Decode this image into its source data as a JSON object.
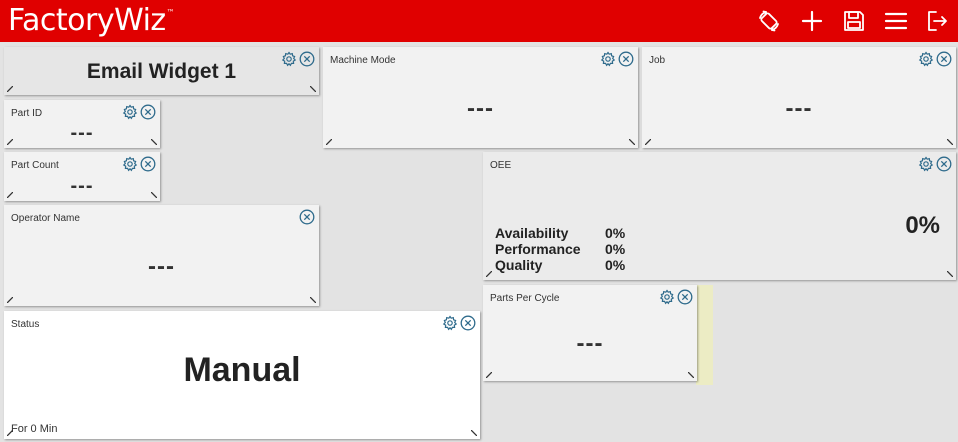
{
  "app": {
    "logo_text": "FactoryWiz",
    "trademark": "™",
    "brand_color": "#e00000"
  },
  "toolbar": {
    "icons": [
      "rotate-screen-icon",
      "plus-icon",
      "save-icon",
      "menu-icon",
      "logout-icon"
    ]
  },
  "widgets": {
    "email": {
      "title": "Email Widget 1"
    },
    "part_id": {
      "title": "Part ID",
      "value": "---"
    },
    "part_count": {
      "title": "Part Count",
      "value": "---"
    },
    "operator_name": {
      "title": "Operator Name",
      "value": "---"
    },
    "status": {
      "title": "Status",
      "value": "Manual",
      "footer": "For 0 Min",
      "background": "#ffffff"
    },
    "machine_mode": {
      "title": "Machine Mode",
      "value": "---"
    },
    "job": {
      "title": "Job",
      "value": "---"
    },
    "oee": {
      "title": "OEE",
      "value": "0%",
      "metrics": [
        {
          "label": "Availability",
          "value": "0%"
        },
        {
          "label": "Performance",
          "value": "0%"
        },
        {
          "label": "Quality",
          "value": "0%"
        }
      ]
    },
    "parts_per_cycle": {
      "title": "Parts Per Cycle",
      "value": "---"
    }
  },
  "colors": {
    "widget_bg": "#f2f2f2",
    "dashboard_bg": "#e3e3e3",
    "control_icon": "#2f6b8c",
    "accent_strip": "#ececc4"
  }
}
